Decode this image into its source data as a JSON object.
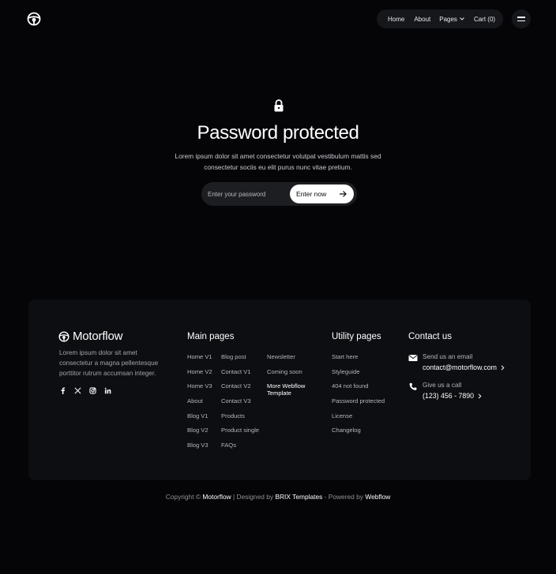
{
  "header": {
    "nav": {
      "home": "Home",
      "about": "About",
      "pages": "Pages",
      "cart": "Cart (0)"
    }
  },
  "hero": {
    "title": "Password protected",
    "text": "Lorem ipsum dolor sit amet consectetur volutpat vestibulum mattis sed consectetur sociis eu elit purus nunc vitae pretium.",
    "input_placeholder": "Enter your password",
    "button_label": "Enter now"
  },
  "footer": {
    "brand": "Motorflow",
    "description": "Lorem ipsum dolor sit amet consectetur a magna pellentesque porttitor rutrum accumsan integer.",
    "main_pages": {
      "title": "Main pages",
      "col1": [
        "Home V1",
        "Home V2",
        "Home V3",
        "About",
        "Blog V1",
        "Blog V2",
        "Blog V3"
      ],
      "col2": [
        "Blog post",
        "Contact V1",
        "Contact V2",
        "Contact V3",
        "Products",
        "Product single",
        "FAQs"
      ],
      "col3": [
        "Newsletter",
        "Coming soon",
        "More Webflow Template"
      ]
    },
    "utility_pages": {
      "title": "Utility pages",
      "links": [
        "Start here",
        "Styleguide",
        "404 not found",
        "Password protected",
        "License",
        "Changelog"
      ]
    },
    "contact": {
      "title": "Contact us",
      "email_label": "Send us an email",
      "email": "contact@motorflow.com",
      "phone_label": "Give us a call",
      "phone": "(123) 456 - 7890"
    },
    "copyright": {
      "prefix": "Copyright ©",
      "brand": "Motorflow",
      "sep1": "| Designed by",
      "designer": "BRIX Templates",
      "sep2": "- Powered by",
      "platform": "Webflow"
    }
  }
}
